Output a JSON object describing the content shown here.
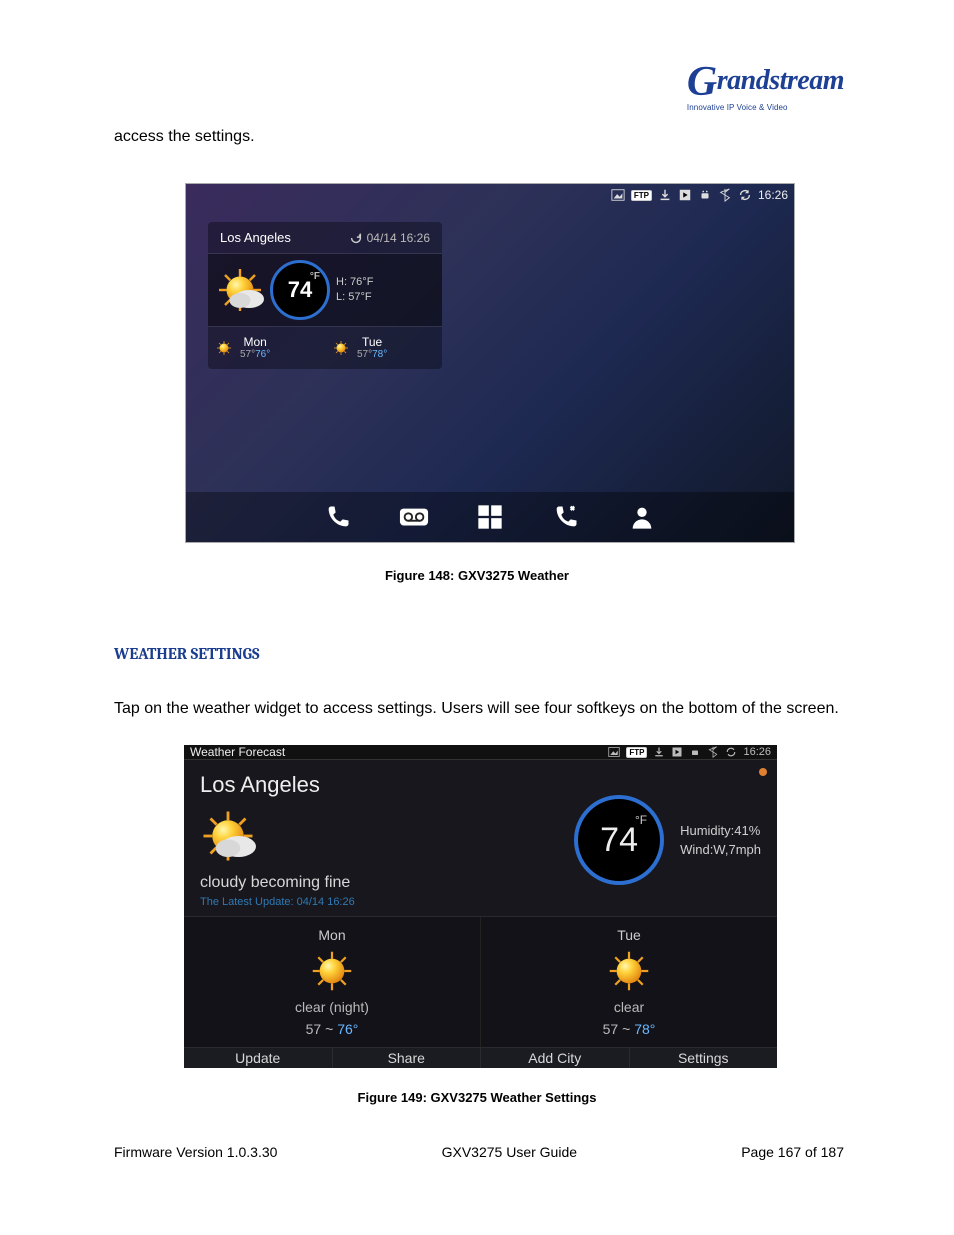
{
  "logo": {
    "brand_prefix": "G",
    "brand_rest": "randstream",
    "tagline": "Innovative IP Voice & Video"
  },
  "intro_text": "access the settings.",
  "fig148": {
    "statusbar": {
      "time": "16:26"
    },
    "widget": {
      "city": "Los Angeles",
      "refresh_time": "04/14 16:26",
      "temp": "74",
      "unit": "°F",
      "hi": "H:  76°F",
      "lo": "L:  57°F",
      "days": [
        {
          "name": "Mon",
          "lo": "57°",
          "hi": "76°"
        },
        {
          "name": "Tue",
          "lo": "57°",
          "hi": "78°"
        }
      ]
    },
    "caption": "Figure 148: GXV3275 Weather"
  },
  "heading": "WEATHER SETTINGS",
  "para": "Tap on the weather widget to access settings. Users will see four softkeys on the bottom of the screen.",
  "fig149": {
    "title": "Weather Forecast",
    "statusbar": {
      "time": "16:26"
    },
    "city": "Los Angeles",
    "condition": "cloudy becoming fine",
    "latest": "The Latest Update:  04/14 16:26",
    "temp": "74",
    "unit": "°F",
    "humidity": "Humidity:41%",
    "wind": "Wind:W,7mph",
    "days": [
      {
        "name": "Mon",
        "cond": "clear (night)",
        "lo": "57",
        "hi": "76°"
      },
      {
        "name": "Tue",
        "cond": "clear",
        "lo": "57",
        "hi": "78°"
      }
    ],
    "softkeys": [
      "Update",
      "Share",
      "Add City",
      "Settings"
    ],
    "caption": "Figure 149: GXV3275 Weather Settings"
  },
  "footer": {
    "left": "Firmware Version 1.0.3.30",
    "center": "GXV3275 User Guide",
    "right": "Page 167 of 187"
  }
}
